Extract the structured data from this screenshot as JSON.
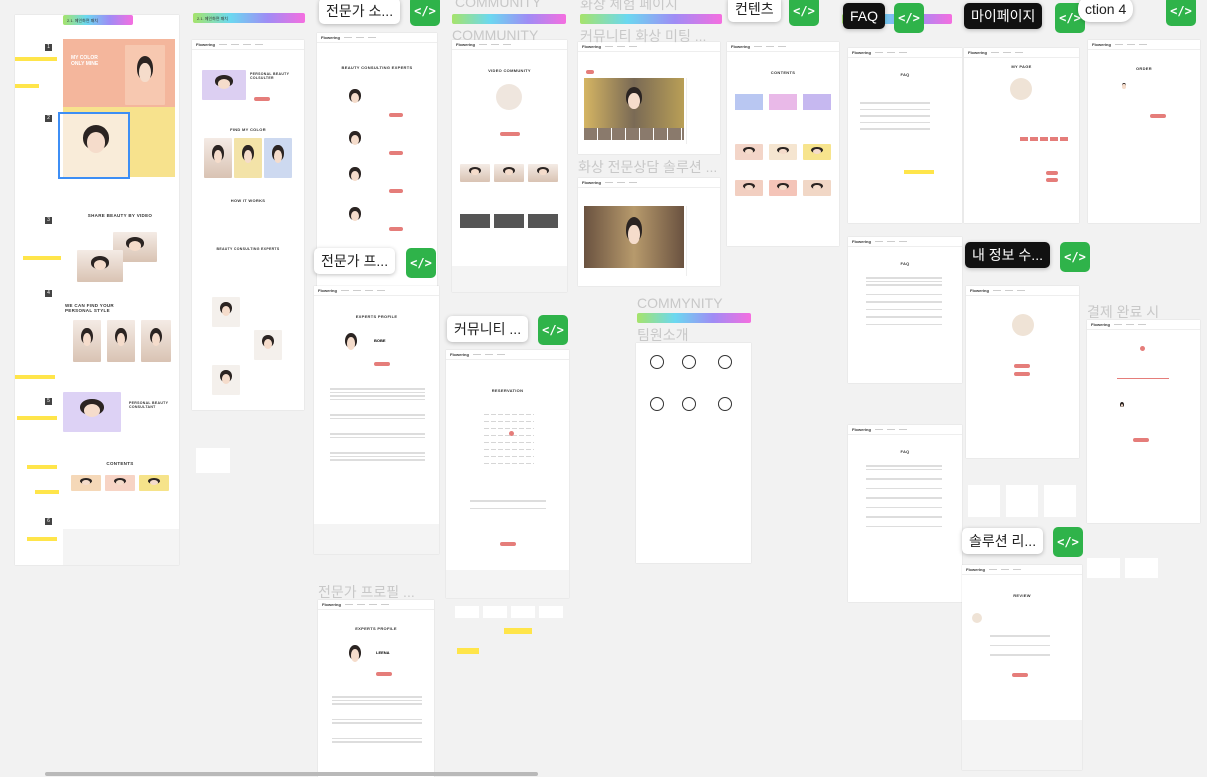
{
  "tags": {
    "expert_consult": "전문가 소...",
    "expert_profile": "전문가 프...",
    "community": "커뮤니티 ...",
    "contents": "컨텐츠",
    "faq": "FAQ",
    "mypage": "마이페이지",
    "my_info": "내 정보 수...",
    "solution": "솔루션 리...",
    "section4": "ction 4"
  },
  "ghost_labels": {
    "community_top": "COMMUNITY",
    "community_sub": "COMMUNITY",
    "video_exp": "화상 체험 페이지",
    "community_video": "커뮤니티 화상 미팅 ...",
    "video_consult": "화상 전문상담 솔루션 ...",
    "commynity": "COMMYNITY",
    "team": "팀원소개",
    "expert_profile2": "전문가 프로필 ...",
    "payment_done": "결제 완료 시"
  },
  "code_icon": "</>",
  "gradient_label": "2.1. 메인화면 패치",
  "boards": {
    "main": {
      "hero_title": "MY COLOR ONLY MINE",
      "share_title": "SHARE BEAUTY BY VIDEO",
      "style_title": "WE CAN FIND YOUR PERSONAL STYLE",
      "consultant_title": "PERSONAL BEAUTY CONSULTANT",
      "contents_title": "CONTENTS",
      "steps": [
        "1",
        "2",
        "3",
        "4",
        "5",
        "6"
      ]
    },
    "personal": {
      "title": "PERSONAL BEAUTY COLSULTER",
      "find_color": "FIND MY COLOR",
      "how_work": "HOW IT WORKS",
      "consult_experts": "BEAUTY CONSULTING EXPERTS"
    },
    "experts": {
      "title": "BEAUTY CONSULTING EXPERTS"
    },
    "community": {
      "title": "VIDEO COMMUNITY"
    },
    "contents": {
      "title": "CONTENTS"
    },
    "faq1": {
      "title": "FAQ"
    },
    "faq2": {
      "title": "FAQ"
    },
    "faq3": {
      "title": "FAQ"
    },
    "mypage": {
      "title": "MY PAGE"
    },
    "order": {
      "title": "ORDER"
    },
    "expert_profile": {
      "title": "EXPERTS PROFILE",
      "name": "BOBE"
    },
    "expert_profile2": {
      "title": "EXPERTS PROFILE",
      "name": "LEENA"
    },
    "reservation": {
      "title": "RESERVATION"
    },
    "review": {
      "title": "REVIEW"
    }
  },
  "brand": "Flowering",
  "colors": {
    "accent": "#e57d7a",
    "green": "#2fb34a",
    "canvas": "#f2f2f2"
  }
}
